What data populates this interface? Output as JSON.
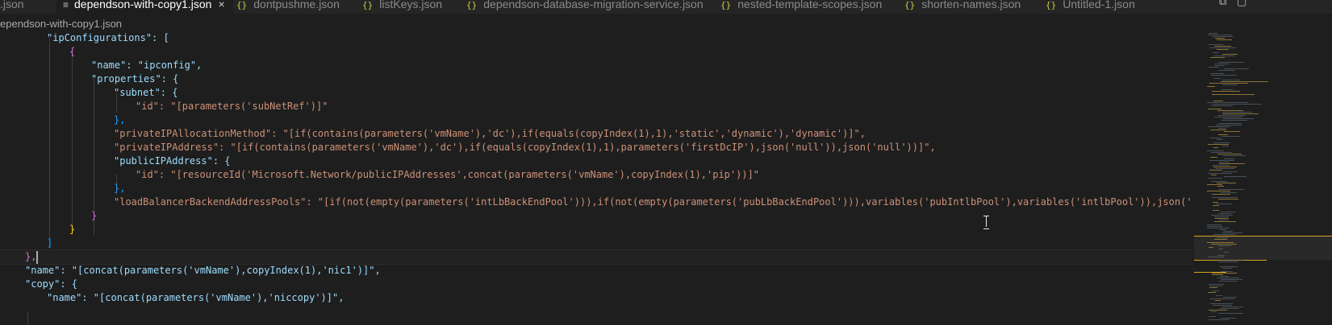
{
  "tabs": [
    {
      "label": ".json",
      "icon": "json-braces-icon",
      "active": false
    },
    {
      "label": "dependson-with-copy1.json",
      "icon": "lines-icon",
      "active": true
    },
    {
      "label": "dontpushme.json",
      "icon": "json-braces-icon",
      "active": false
    },
    {
      "label": "listKeys.json",
      "icon": "json-braces-icon",
      "active": false
    },
    {
      "label": "dependson-database-migration-service.json",
      "icon": "json-braces-icon",
      "active": false
    },
    {
      "label": "nested-template-scopes.json",
      "icon": "json-braces-icon",
      "active": false
    },
    {
      "label": "shorten-names.json",
      "icon": "json-braces-icon",
      "active": false
    },
    {
      "label": "Untitled-1.json",
      "icon": "json-braces-icon",
      "active": false
    }
  ],
  "tab_icons": {
    "json": "{}",
    "lines": "≡",
    "close": "×"
  },
  "toolbar_icons": [
    "split-editor-icon",
    "layout-icon"
  ],
  "breadcrumb": "ependson-with-copy1.json",
  "code_lines": [
    "\"ipConfigurations\": [",
    "{",
    "\"name\": \"ipconfig\",",
    "\"properties\": {",
    "\"subnet\": {",
    "\"id\": \"[parameters('subNetRef')]\"",
    "},",
    "\"privateIPAllocationMethod\": \"[if(contains(parameters('vmName'),'dc'),if(equals(copyIndex(1),1),'static','dynamic'),'dynamic')]\",",
    "\"privateIPAddress\": \"[if(contains(parameters('vmName'),'dc'),if(equals(copyIndex(1),1),parameters('firstDcIP'),json('null')),json('null'))]\",",
    "\"publicIPAddress\": {",
    "\"id\": \"[resourceId('Microsoft.Network/publicIPAddresses',concat(parameters('vmName'),copyIndex(1),'pip'))]\"",
    "},",
    "\"loadBalancerBackendAddressPools\": \"[if(not(empty(parameters('intLbBackEndPool'))),if(not(empty(parameters('pubLbBackEndPool'))),variables('pubIntlbPool'),variables('intlbPool')),json('null'))]\"",
    "}",
    "}",
    "]",
    "},",
    "\"name\": \"[concat(parameters('vmName'),copyIndex(1),'nic1')]\",",
    "\"copy\": {",
    "\"name\": \"[concat(parameters('vmName'),'niccopy')]\","
  ],
  "colors": {
    "background": "#1e1e1e",
    "key": "#9cdcfe",
    "string": "#ce9178",
    "template_function": "#4ec9b0",
    "bracket_gold": "#ffd700",
    "bracket_orchid": "#da70d6",
    "minimap_highlight": "#d9a21f"
  }
}
